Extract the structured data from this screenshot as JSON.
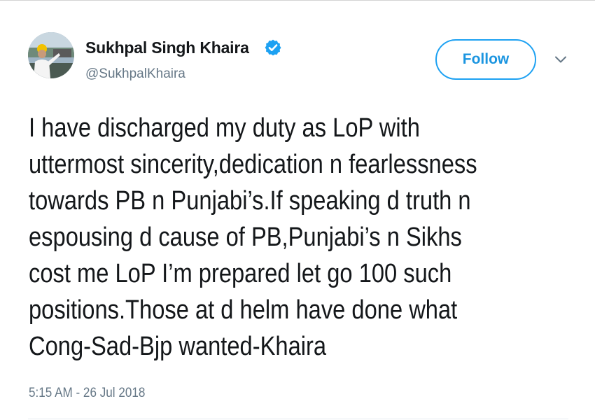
{
  "tweet": {
    "author": {
      "display_name": "Sukhpal Singh Khaira",
      "handle": "@SukhpalKhaira",
      "verified": true,
      "avatar_icon": "profile-photo"
    },
    "follow_label": "Follow",
    "menu_icon": "chevron-down-icon",
    "text_lines": [
      "I have discharged my duty as LoP with",
      "uttermost sincerity,dedication n fearlessness",
      "towards PB n Punjabi’s.If speaking d truth n",
      "espousing d cause of PB,Punjabi’s n Sikhs",
      "cost me LoP I’m prepared let go 100 such",
      "positions.Those at d helm have done what",
      "Cong-Sad-Bjp wanted-Khaira"
    ],
    "timestamp": "5:15 AM - 26 Jul 2018"
  },
  "colors": {
    "accent": "#1da1f2",
    "text_primary": "#14171a",
    "text_secondary": "#657786"
  }
}
